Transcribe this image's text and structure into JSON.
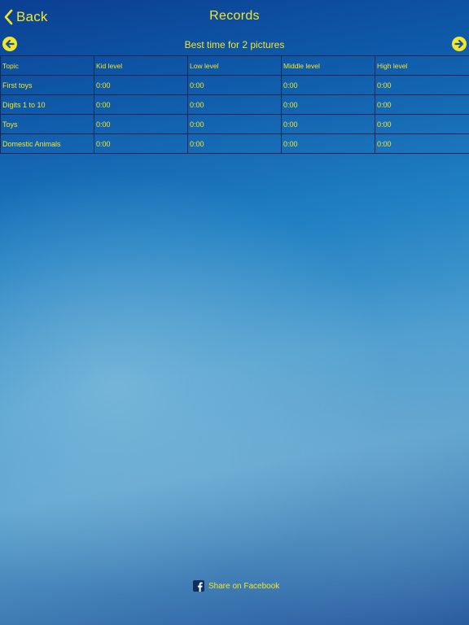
{
  "nav": {
    "back_label": "Back",
    "title": "Records"
  },
  "subtitle": "Best time for 2 pictures",
  "icons": {
    "back": "chevron-left-icon",
    "prev": "arrow-left-circle-icon",
    "next": "arrow-right-circle-icon",
    "share": "facebook-icon"
  },
  "colors": {
    "text": "#f2e62b",
    "grid_line": "#0a2a55",
    "background_top": "#0b3f93",
    "background_mid": "#5ea4cf"
  },
  "table": {
    "columns": [
      "Topic",
      "Kid level",
      "Low level",
      "Middle level",
      "High level"
    ],
    "rows": [
      {
        "topic": "First toys",
        "kid": "0:00",
        "low": "0:00",
        "middle": "0:00",
        "high": "0:00"
      },
      {
        "topic": "Digits 1 to 10",
        "kid": "0:00",
        "low": "0:00",
        "middle": "0:00",
        "high": "0:00"
      },
      {
        "topic": "Toys",
        "kid": "0:00",
        "low": "0:00",
        "middle": "0:00",
        "high": "0:00"
      },
      {
        "topic": "Domestic Animals",
        "kid": "0:00",
        "low": "0:00",
        "middle": "0:00",
        "high": "0:00"
      }
    ]
  },
  "share": {
    "label": "Share on Facebook"
  }
}
